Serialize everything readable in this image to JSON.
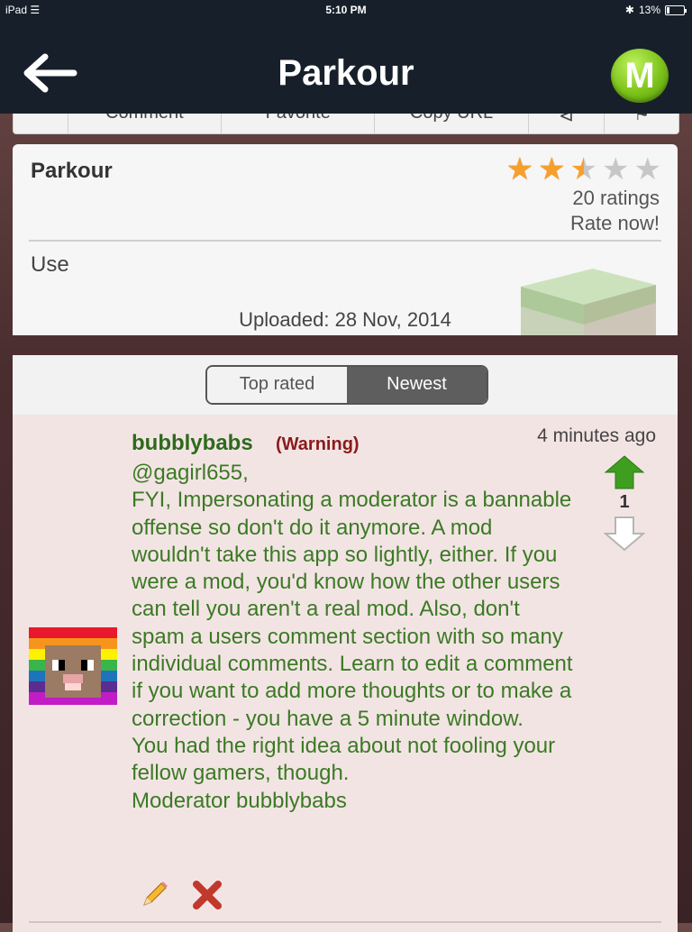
{
  "status_bar": {
    "device": "iPad",
    "time": "5:10 PM",
    "battery": "13%"
  },
  "nav": {
    "title": "Parkour",
    "logo_letter": "M"
  },
  "toolbar": {
    "items": [
      "",
      "Comment",
      "Favorite",
      "Copy URL",
      "",
      ""
    ]
  },
  "details": {
    "title": "Parkour",
    "rating": 2.5,
    "rating_max": 5,
    "ratings_count": "20 ratings",
    "rate_now": "Rate now!",
    "description": "Use",
    "uploaded": "Uploaded: 28 Nov, 2014"
  },
  "comments": {
    "sort_tabs": [
      "Top rated",
      "Newest"
    ],
    "active_tab": "Newest",
    "items": [
      {
        "username": "bubblybabs",
        "tag": "(Warning)",
        "time": "4 minutes ago",
        "votes": "1",
        "body": "@gagirl655,\nFYI, Impersonating a moderator is a bannable offense so don't do it anymore. A mod wouldn't take this app so lightly, either. If you were a mod, you'd know how the other users can tell you aren't a real mod. Also, don't spam a users comment section with so many individual comments. Learn to edit a comment if you want to add more thoughts or to make a correction - you have a 5 minute window.\nYou had the right idea about not fooling your fellow gamers, though.\nModerator bubblybabs"
      }
    ]
  },
  "colors": {
    "nav_bg": "#17202a",
    "star_filled": "#f5a02c",
    "star_empty": "#c7c7c7",
    "username": "#2d6a1c",
    "warning": "#8b1a1a",
    "comment_text": "#3b7a24",
    "comment_bg": "#f3e4e4",
    "upvote": "#3f9e1f"
  }
}
